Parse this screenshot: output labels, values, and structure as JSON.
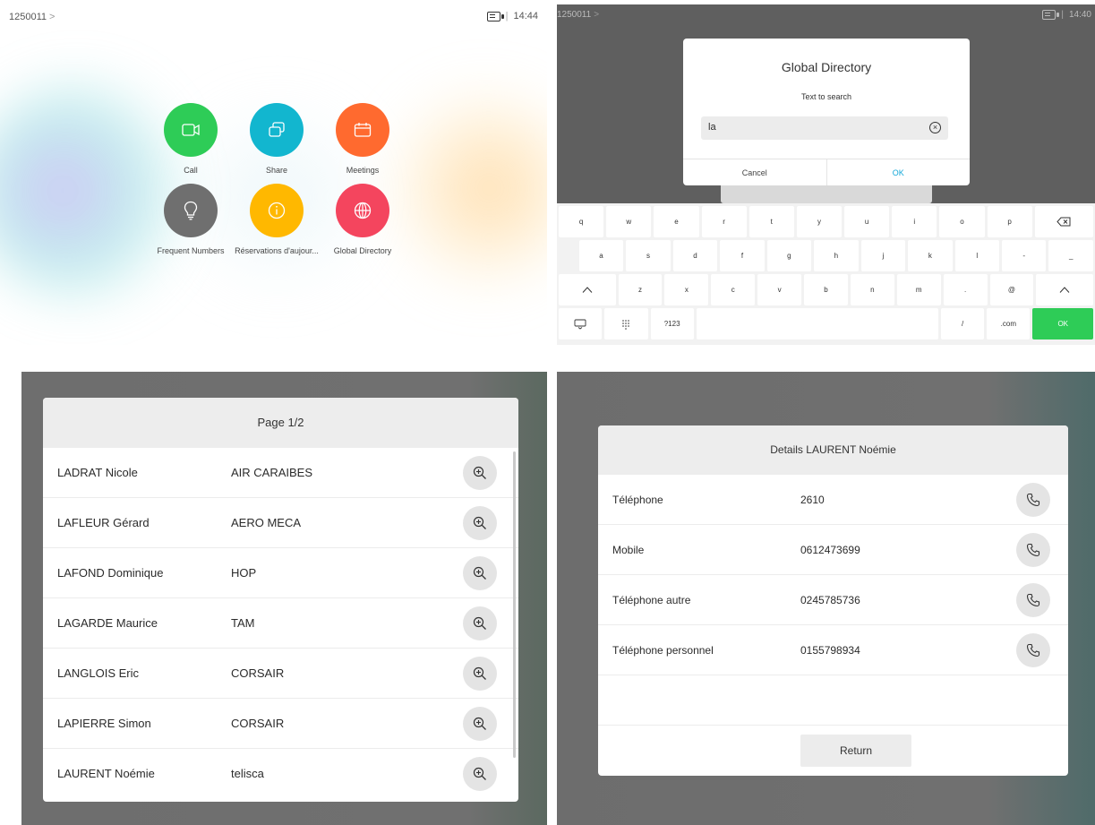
{
  "status": {
    "system_id": "1250011",
    "chevron": ">",
    "separator": "|",
    "time_home": "14:44",
    "time_dialog": "14:40"
  },
  "home": {
    "apps": [
      {
        "label": "Call",
        "icon": "video-camera-icon",
        "color": "#2ecc57"
      },
      {
        "label": "Share",
        "icon": "share-screen-icon",
        "color": "#12b6cf"
      },
      {
        "label": "Meetings",
        "icon": "calendar-icon",
        "color": "#ff6a2f"
      },
      {
        "label": "Frequent Numbers",
        "icon": "lightbulb-icon",
        "color": "#6f6f6f"
      },
      {
        "label": "Réservations d'aujour...",
        "icon": "info-icon",
        "color": "#ffb800"
      },
      {
        "label": "Global Directory",
        "icon": "globe-icon",
        "color": "#f4455e"
      }
    ]
  },
  "search_dialog": {
    "title": "Global Directory",
    "subtitle": "Text to search",
    "input_value": "la",
    "cancel_label": "Cancel",
    "ok_label": "OK"
  },
  "keyboard": {
    "row1": [
      "q",
      "w",
      "e",
      "r",
      "t",
      "y",
      "u",
      "i",
      "o",
      "p"
    ],
    "row2": [
      "a",
      "s",
      "d",
      "f",
      "g",
      "h",
      "j",
      "k",
      "l",
      "-",
      "_"
    ],
    "row3": [
      "z",
      "x",
      "c",
      "v",
      "b",
      "n",
      "m",
      ".",
      "@"
    ],
    "row4": {
      "numpad_label": "?123",
      "slash": "/",
      "dotcom": ".com",
      "ok": "OK"
    }
  },
  "results": {
    "header": "Page 1/2",
    "rows": [
      {
        "name": "LADRAT Nicole",
        "company": "AIR CARAIBES"
      },
      {
        "name": "LAFLEUR Gérard",
        "company": "AERO MECA"
      },
      {
        "name": "LAFOND Dominique",
        "company": "HOP"
      },
      {
        "name": "LAGARDE Maurice",
        "company": "TAM"
      },
      {
        "name": "LANGLOIS Eric",
        "company": "CORSAIR"
      },
      {
        "name": "LAPIERRE Simon",
        "company": "CORSAIR"
      },
      {
        "name": "LAURENT Noémie",
        "company": "telisca"
      }
    ]
  },
  "details": {
    "header": "Details LAURENT Noémie",
    "rows": [
      {
        "label": "Téléphone",
        "value": "2610"
      },
      {
        "label": "Mobile",
        "value": "0612473699"
      },
      {
        "label": "Téléphone autre",
        "value": "0245785736"
      },
      {
        "label": "Téléphone personnel",
        "value": "0155798934"
      }
    ],
    "return_label": "Return"
  }
}
